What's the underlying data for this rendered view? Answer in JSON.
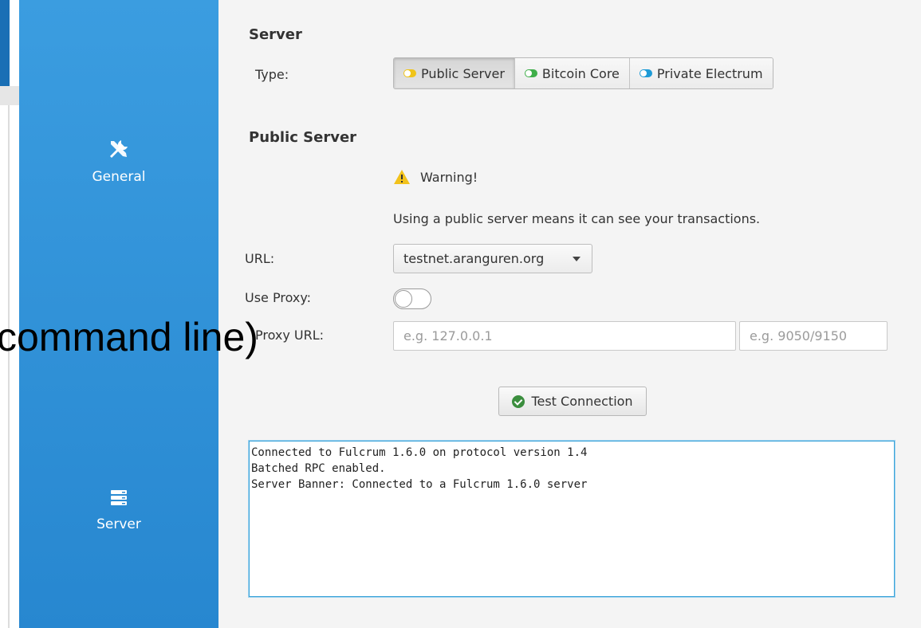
{
  "sidebar": {
    "items": [
      {
        "label": "General",
        "icon": "tools-icon"
      },
      {
        "label": "Server",
        "icon": "server-icon"
      }
    ]
  },
  "overlay_text": "command line)",
  "server": {
    "title": "Server",
    "type_label": "Type:",
    "types": [
      {
        "label": "Public Server",
        "color": "#f0c419",
        "active": true
      },
      {
        "label": "Bitcoin Core",
        "color": "#3fae49",
        "active": false
      },
      {
        "label": "Private Electrum",
        "color": "#1d9bd7",
        "active": false
      }
    ]
  },
  "public_server": {
    "title": "Public Server",
    "warning": "Warning!",
    "info": "Using a public server means it can see your transactions.",
    "url_label": "URL:",
    "url_value": "testnet.aranguren.org",
    "proxy_label": "Use Proxy:",
    "proxy_url_label": "Proxy URL:",
    "proxy_host_placeholder": "e.g. 127.0.0.1",
    "proxy_port_placeholder": "e.g. 9050/9150",
    "test_button": "Test Connection"
  },
  "output": {
    "lines": [
      "Connected to Fulcrum 1.6.0 on protocol version 1.4",
      "Batched RPC enabled.",
      "Server Banner: Connected to a Fulcrum 1.6.0 server"
    ]
  }
}
